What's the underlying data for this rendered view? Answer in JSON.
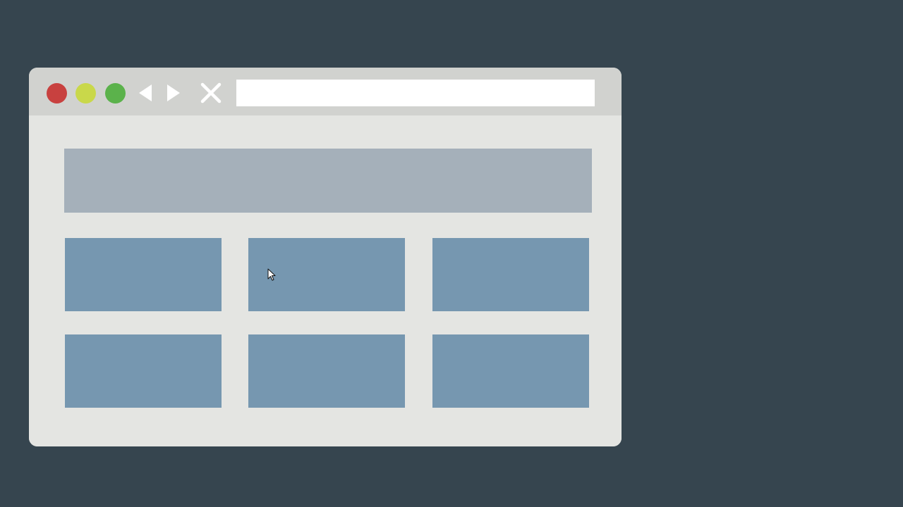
{
  "window": {
    "traffic_lights": [
      {
        "name": "close",
        "color": "#c8413f"
      },
      {
        "name": "minimize",
        "color": "#c9d84a"
      },
      {
        "name": "maximize",
        "color": "#5bb24b"
      }
    ],
    "nav_icons": {
      "back": "triangle-left-icon",
      "forward": "triangle-right-icon",
      "stop": "x-icon"
    },
    "address_bar": {
      "value": "",
      "placeholder": ""
    }
  },
  "colors": {
    "background": "#36454f",
    "window": "#e4e5e2",
    "titlebar": "#d1d2cf",
    "header_block": "#a5b0ba",
    "tile": "#7697b0"
  },
  "content": {
    "header_block_label": "",
    "tiles": [
      {
        "label": ""
      },
      {
        "label": ""
      },
      {
        "label": ""
      },
      {
        "label": ""
      },
      {
        "label": ""
      },
      {
        "label": ""
      }
    ]
  }
}
